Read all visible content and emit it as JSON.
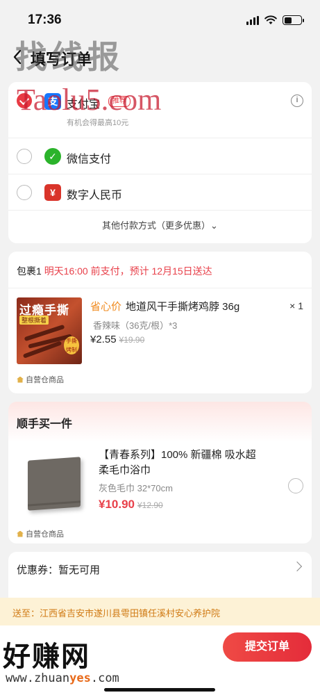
{
  "status_bar": {
    "time": "17:36",
    "battery_level": 0.45
  },
  "nav": {
    "title": "填写订单"
  },
  "watermarks": {
    "top_cn": "找线报",
    "top_en": "Taolu5.com",
    "bottom_cn": "好赚网",
    "bottom_url_prefix": "www.zhuan",
    "bottom_url_mid": "yes",
    "bottom_url_suffix": ".com"
  },
  "payment": {
    "options": [
      {
        "name": "支付宝",
        "tag": "推荐",
        "subtitle": "有机会得最高10元",
        "selected": true,
        "icon": "alipay-icon",
        "icon_glyph": "支",
        "color": "#1677ff"
      },
      {
        "name": "微信支付",
        "selected": false,
        "icon": "wechat-pay-icon",
        "icon_glyph": "✓",
        "color": "#2bb32b"
      },
      {
        "name": "数字人民币",
        "selected": false,
        "icon": "digital-rmb-icon",
        "icon_glyph": "¥",
        "color": "#d9342a"
      }
    ],
    "info_glyph": "i",
    "other_methods": "其他付款方式（更多优惠）⌄"
  },
  "package": {
    "label": "包裹1",
    "delivery_note": "明天16:00 前支付，预计 12月15日送达",
    "product": {
      "promo": "省心价",
      "name": "地道风干手撕烤鸡脖 36g",
      "quantity": "× 1",
      "spec": "香辣味（36克/根）*3",
      "price": "¥2.55",
      "original_price": "¥19.90",
      "image_title": "过瘾手撕",
      "image_tag": "整根撕着",
      "image_badge": "手撕 烤制"
    },
    "self_operated": "自营仓商品"
  },
  "addon": {
    "title": "顺手买一件",
    "product": {
      "name": "【青春系列】100% 新疆棉 吸水超柔毛巾浴巾",
      "spec": "灰色毛巾 32*70cm",
      "price": "¥10.90",
      "original_price": "¥12.90"
    },
    "self_operated": "自营仓商品"
  },
  "coupon": {
    "label": "优惠券：暂无可用"
  },
  "address": {
    "text": "送至：江西省吉安市遂川县雩田镇任溪村安心养护院"
  },
  "footer": {
    "submit_label": "提交订单"
  },
  "colors": {
    "accent": "#e8404a",
    "promo": "#f08a1e",
    "address_bg": "#fdf2d6"
  }
}
